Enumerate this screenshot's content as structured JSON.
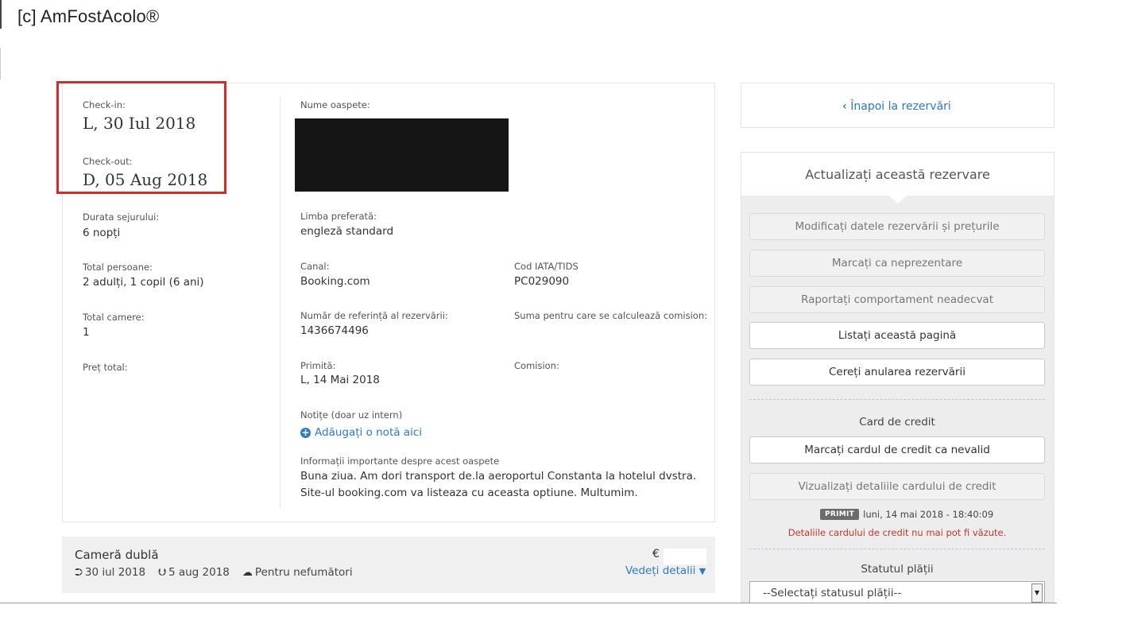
{
  "watermark": "[c] AmFostAcolo®",
  "stay": {
    "checkin_label": "Check-in:",
    "checkin_value": "L, 30 Iul 2018",
    "checkout_label": "Check-out:",
    "checkout_value": "D, 05 Aug 2018",
    "duration_label": "Durata sejurului:",
    "duration_value": "6 nopți",
    "persons_label": "Total persoane:",
    "persons_value": "2 adulți, 1 copil (6 ani)",
    "rooms_label": "Total camere:",
    "rooms_value": "1",
    "price_label": "Preț total:"
  },
  "guest": {
    "name_label": "Nume oaspete:",
    "language_label": "Limba preferată:",
    "language_value": "engleză standard",
    "channel_label": "Canal:",
    "channel_value": "Booking.com",
    "iata_label": "Cod IATA/TIDS",
    "iata_value": "PC029090",
    "ref_label": "Număr de referință al rezervării:",
    "ref_value": "1436674496",
    "commission_base_label": "Suma pentru care se calculează comision:",
    "received_label": "Primită:",
    "received_value": "L, 14 Mai 2018",
    "commission_label": "Comision:",
    "notes_label": "Notițe (doar uz intern)",
    "add_note": "Adăugați o notă aici",
    "info_label": "Informații importante despre acest oaspete",
    "info_text": "Buna ziua. Am dori transport de.la aeroportul Constanta la hotelul dvstra. Site-ul booking.com va listeaza cu aceasta optiune. Multumim."
  },
  "room": {
    "title": "Cameră dublă",
    "checkin": "30 iul 2018",
    "checkout": "5 aug 2018",
    "smoking": "Pentru nefumători",
    "currency": "€",
    "details_link": "Vedeți detalii"
  },
  "sidebar": {
    "back_link": "Înapoi la rezervări",
    "update_title": "Actualizați această rezervare",
    "buttons": [
      "Modificați datele rezervării și prețurile",
      "Marcați ca neprezentare",
      "Raportați comportament neadecvat",
      "Listați această pagină",
      "Cereți anularea rezervării"
    ],
    "card_section": "Card de credit",
    "card_invalid": "Marcați cardul de credit ca nevalid",
    "card_view": "Vizualizați detaliile cardului de credit",
    "received_badge": "PRIMIT",
    "received_time": "luni, 14 mai 2018 - 18:40:09",
    "card_warning": "Detaliile cardului de credit nu mai pot fi văzute.",
    "payment_section": "Statutul plății",
    "payment_select": "--Selectați statusul plății--"
  }
}
